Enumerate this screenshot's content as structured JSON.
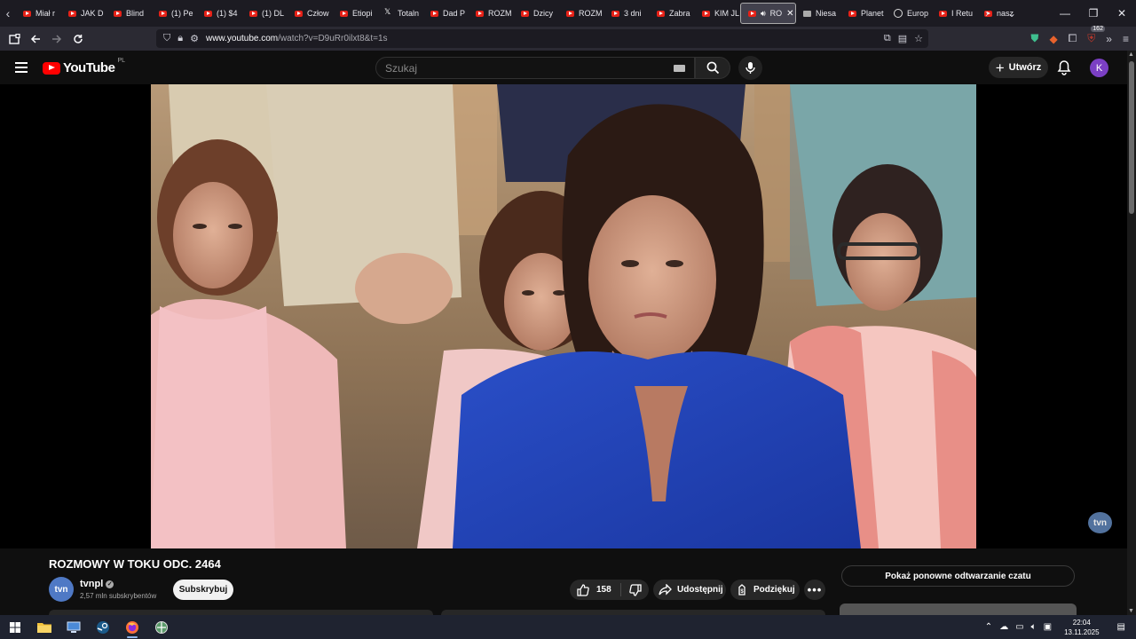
{
  "browser": {
    "tabs": [
      {
        "label": "Miał r",
        "favicon": "youtube-icon"
      },
      {
        "label": "JAK D",
        "favicon": "youtube-icon"
      },
      {
        "label": "Blind",
        "favicon": "youtube-icon"
      },
      {
        "label": "(1) Pe",
        "favicon": "youtube-icon"
      },
      {
        "label": "(1) $4",
        "favicon": "youtube-icon"
      },
      {
        "label": "(1) DL",
        "favicon": "youtube-icon"
      },
      {
        "label": "Człow",
        "favicon": "youtube-icon"
      },
      {
        "label": "Etiopi",
        "favicon": "youtube-icon"
      },
      {
        "label": "Totaln",
        "favicon": "x-icon"
      },
      {
        "label": "Dad P",
        "favicon": "youtube-icon"
      },
      {
        "label": "ROZM",
        "favicon": "youtube-icon"
      },
      {
        "label": "Dzicy",
        "favicon": "youtube-icon"
      },
      {
        "label": "ROZM",
        "favicon": "youtube-icon"
      },
      {
        "label": "3 dni",
        "favicon": "youtube-icon"
      },
      {
        "label": "Zabra",
        "favicon": "youtube-icon"
      },
      {
        "label": "KIM JL",
        "favicon": "youtube-icon"
      },
      {
        "label": "RO",
        "favicon": "youtube-icon",
        "active": true
      },
      {
        "label": "Niesa",
        "favicon": "image-icon"
      },
      {
        "label": "Planet",
        "favicon": "youtube-icon"
      },
      {
        "label": "Europ",
        "favicon": "globe-icon"
      },
      {
        "label": "I Retu",
        "favicon": "youtube-icon"
      },
      {
        "label": "nasz",
        "favicon": "youtube-icon"
      }
    ],
    "url_domain": "www.youtube.com",
    "url_path": "/watch?v=D9uRr0ilxt8&t=1s",
    "extensions_badge": "162"
  },
  "youtube": {
    "logo_text": "YouTube",
    "country_code": "PL",
    "search_placeholder": "Szukaj",
    "create_label": "Utwórz",
    "avatar_letter": "K",
    "accent": "#ff0000"
  },
  "video": {
    "title": "ROZMOWY W TOKU ODC. 2464",
    "watermark": "tvn",
    "channel": {
      "avatar_text": "tvn",
      "name": "tvnpl",
      "subscribers": "2,57 mln subskrybentów",
      "subscribe_label": "Subskrybuj"
    },
    "likes": "158",
    "share_label": "Udostępnij",
    "thanks_label": "Podziękuj",
    "chat_replay_label": "Pokaż ponowne odtwarzanie czatu"
  },
  "taskbar": {
    "time": "22:04",
    "date": "13.11.2025"
  }
}
